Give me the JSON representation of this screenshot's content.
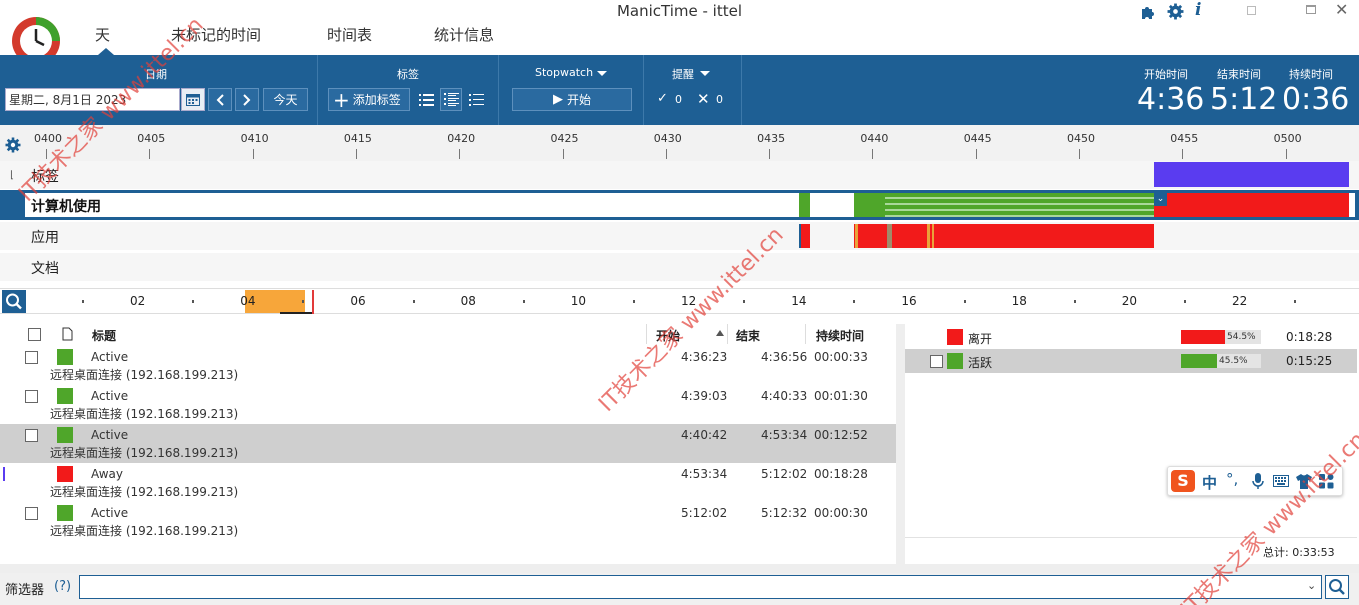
{
  "window": {
    "title": "ManicTime - ittel"
  },
  "nav": {
    "tabs": [
      "天",
      "未标记的时间",
      "时间表",
      "统计信息"
    ]
  },
  "toolbar": {
    "date_label": "日期",
    "date_value": "星期二, 8月1日 2023",
    "today_label": "今天",
    "tags_label": "标签",
    "add_tag_label": "添加标签",
    "stopwatch_label": "Stopwatch",
    "start_label": "开始",
    "reminder_label": "提醒",
    "check_count": "0",
    "x_count": "0",
    "start_time_label": "开始时间",
    "end_time_label": "结束时间",
    "duration_label": "持续时间",
    "start_time": "4:36",
    "end_time": "5:12",
    "duration": "0:36"
  },
  "ruler": {
    "ticks": [
      "0400",
      "0405",
      "0410",
      "0415",
      "0420",
      "0425",
      "0430",
      "0435",
      "0440",
      "0445",
      "0450",
      "0455",
      "0500"
    ]
  },
  "tracks": {
    "tags": "标签",
    "computer_usage": "计算机使用",
    "apps": "应用",
    "docs": "文档"
  },
  "overview": {
    "labels": [
      "02",
      "04",
      "06",
      "08",
      "10",
      "12",
      "14",
      "16",
      "18",
      "20",
      "22"
    ]
  },
  "list": {
    "headers": {
      "title": "标题",
      "start": "开始",
      "end": "结束",
      "duration": "持续时间"
    },
    "rows": [
      {
        "title": "Active",
        "subtitle": "远程桌面连接 (192.168.199.213)",
        "start": "4:36:23",
        "end": "4:36:56",
        "duration": "00:00:33",
        "color": "#4fa62a",
        "selected": false
      },
      {
        "title": "Active",
        "subtitle": "远程桌面连接 (192.168.199.213)",
        "start": "4:39:03",
        "end": "4:40:33",
        "duration": "00:01:30",
        "color": "#4fa62a",
        "selected": false
      },
      {
        "title": "Active",
        "subtitle": "远程桌面连接 (192.168.199.213)",
        "start": "4:40:42",
        "end": "4:53:34",
        "duration": "00:12:52",
        "color": "#4fa62a",
        "selected": true
      },
      {
        "title": "Away",
        "subtitle": "远程桌面连接 (192.168.199.213)",
        "start": "4:53:34",
        "end": "5:12:02",
        "duration": "00:18:28",
        "color": "#f21a1a",
        "selected": false
      },
      {
        "title": "Active",
        "subtitle": "远程桌面连接 (192.168.199.213)",
        "start": "5:12:02",
        "end": "5:12:32",
        "duration": "00:00:30",
        "color": "#4fa62a",
        "selected": false
      }
    ]
  },
  "summary": {
    "items": [
      {
        "label": "离开",
        "percent": 54.5,
        "percent_label": "54.5%",
        "duration": "0:18:28",
        "color": "#f21a1a"
      },
      {
        "label": "活跃",
        "percent": 45.5,
        "percent_label": "45.5%",
        "duration": "0:15:25",
        "color": "#4fa62a"
      }
    ],
    "total_label": "总计: 0:33:53"
  },
  "filter": {
    "label": "筛选器",
    "help": "(?)"
  },
  "ime": {
    "lang": "中"
  },
  "watermark": {
    "text": "IT技术之家 www.ittel.cn"
  },
  "colors": {
    "toolbar": "#1e5f94",
    "active": "#4fa62a",
    "away": "#f21a1a",
    "tag": "#5a3cf0",
    "overview_highlight": "#f7a63a"
  }
}
